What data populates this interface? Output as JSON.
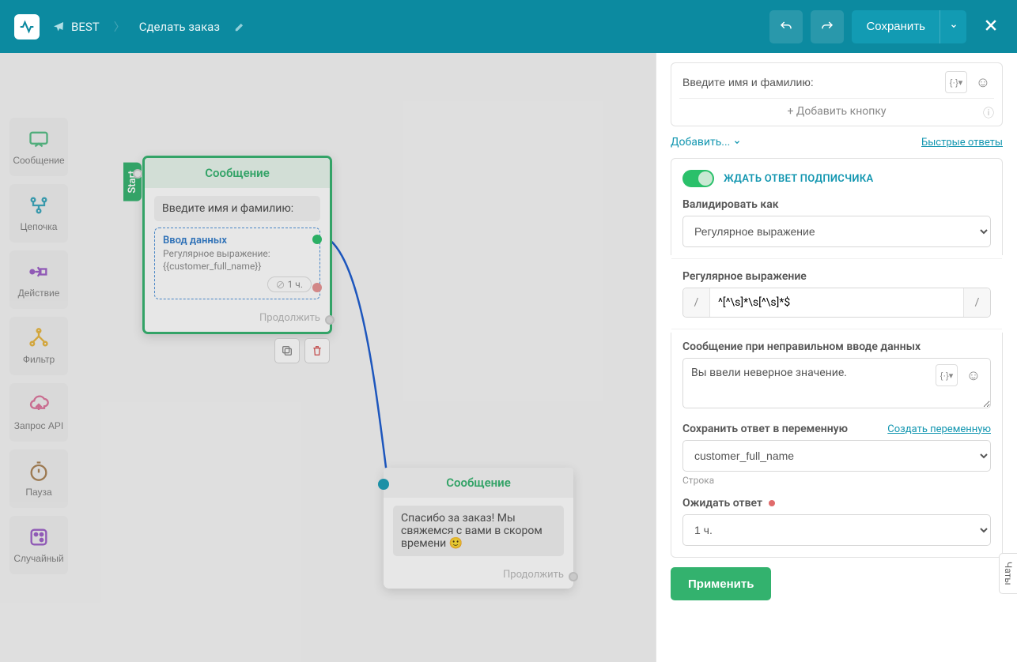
{
  "header": {
    "bot_name": "BEST",
    "page_title": "Сделать заказ",
    "save_label": "Сохранить"
  },
  "toolbox": [
    {
      "label": "Сообщение",
      "color": "#33b26e"
    },
    {
      "label": "Цепочка",
      "color": "#1296b0"
    },
    {
      "label": "Действие",
      "color": "#8a3fbf"
    },
    {
      "label": "Фильтр",
      "color": "#e6a817"
    },
    {
      "label": "Запрос API",
      "color": "#d85a8a"
    },
    {
      "label": "Пауза",
      "color": "#9a6a33"
    },
    {
      "label": "Случайный",
      "color": "#8a3fbf"
    }
  ],
  "canvas": {
    "node1": {
      "start_label": "Start",
      "title": "Сообщение",
      "message": "Введите имя и фамилию:",
      "input_title": "Ввод данных",
      "input_sub1": "Регулярное выражение:",
      "input_sub2": "{{customer_full_name}}",
      "wait": "1 ч.",
      "footer": "Продолжить"
    },
    "node2": {
      "title": "Сообщение",
      "message": "Спасибо за заказ! Мы свяжемся с вами в скором времени 🙂",
      "footer": "Продолжить"
    }
  },
  "panel": {
    "msg_value": "Введите имя и фамилию:",
    "add_button_label": "+ Добавить кнопку",
    "add_link": "Добавить...",
    "quick_replies": "Быстрые ответы",
    "toggle_label": "ЖДАТЬ ОТВЕТ ПОДПИСЧИКА",
    "validate_label": "Валидировать как",
    "validate_value": "Регулярное выражение",
    "regex_label": "Регулярное выражение",
    "regex_value": "^[^\\s]*\\s[^\\s]*$",
    "error_msg_label": "Сообщение при неправильном вводе данных",
    "error_msg_value": "Вы ввели неверное значение.",
    "save_var_label": "Сохранить ответ в переменную",
    "create_var_link": "Создать переменную",
    "save_var_value": "customer_full_name",
    "var_type_hint": "Строка",
    "wait_label": "Ожидать ответ",
    "wait_value": "1 ч.",
    "apply_label": "Применить"
  },
  "chat_tab": "Чаты"
}
